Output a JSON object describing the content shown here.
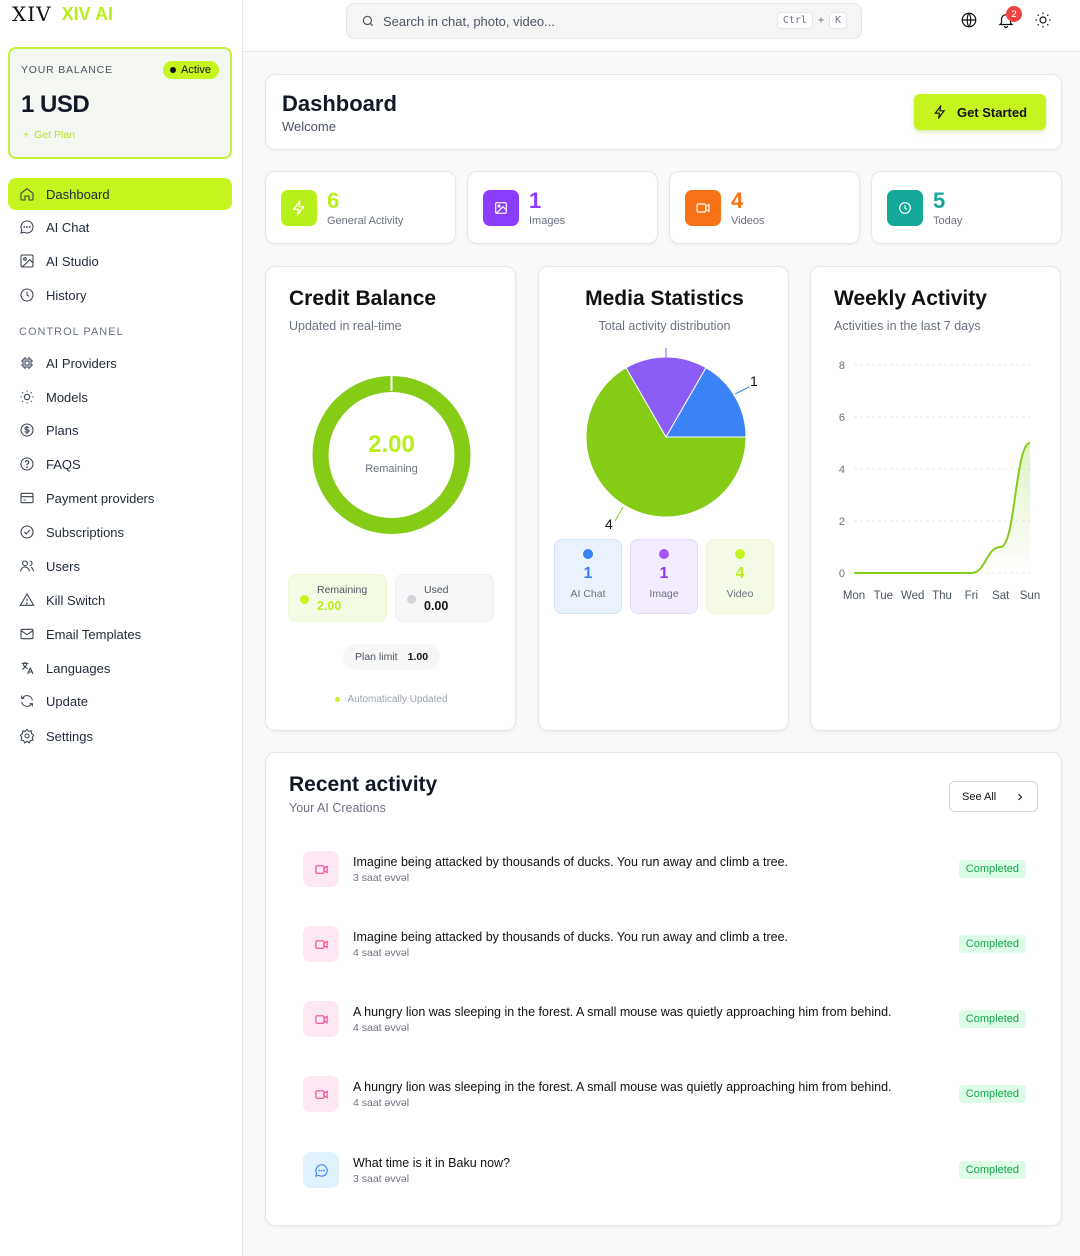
{
  "app": {
    "logo_mark": "XIV",
    "name": "XIV AI"
  },
  "balance": {
    "label": "YOUR BALANCE",
    "status": "Active",
    "amount": "1 USD",
    "get_plan": "Get Plan"
  },
  "sidebar": {
    "items": [
      {
        "label": "Dashboard",
        "icon": "home-icon"
      },
      {
        "label": "AI Chat",
        "icon": "chat-icon"
      },
      {
        "label": "AI Studio",
        "icon": "image-icon"
      },
      {
        "label": "History",
        "icon": "clock-icon"
      }
    ],
    "section_label": "CONTROL PANEL",
    "control_items": [
      {
        "label": "AI Providers",
        "icon": "chip-icon"
      },
      {
        "label": "Models",
        "icon": "bulb-icon"
      },
      {
        "label": "Plans",
        "icon": "dollar-icon"
      },
      {
        "label": "FAQS",
        "icon": "help-icon"
      },
      {
        "label": "Payment providers",
        "icon": "card-icon"
      },
      {
        "label": "Subscriptions",
        "icon": "check-circle-icon"
      },
      {
        "label": "Users",
        "icon": "users-icon"
      },
      {
        "label": "Kill Switch",
        "icon": "warning-icon"
      },
      {
        "label": "Email Templates",
        "icon": "mail-icon"
      },
      {
        "label": "Languages",
        "icon": "translate-icon"
      },
      {
        "label": "Update",
        "icon": "refresh-icon"
      },
      {
        "label": "Settings",
        "icon": "gear-icon"
      }
    ]
  },
  "search": {
    "placeholder": "Search in chat, photo, video...",
    "kbd_1": "Ctrl",
    "kbd_plus": "+",
    "kbd_2": "K"
  },
  "notifications": {
    "count": "2"
  },
  "header": {
    "title": "Dashboard",
    "subtitle": "Welcome",
    "cta": "Get Started"
  },
  "stats": [
    {
      "value": "6",
      "label": "General Activity",
      "color": "#b7ef1a",
      "icon": "bolt-icon"
    },
    {
      "value": "1",
      "label": "Images",
      "color": "#8b3dff",
      "icon": "image-icon"
    },
    {
      "value": "4",
      "label": "Videos",
      "color": "#f97316",
      "icon": "video-icon"
    },
    {
      "value": "5",
      "label": "Today",
      "color": "#14a89a",
      "icon": "clock-icon"
    }
  ],
  "credit": {
    "title": "Credit Balance",
    "subtitle": "Updated in real-time",
    "center_value": "2.00",
    "center_label": "Remaining",
    "remaining_fraction": 1.0,
    "remaining_label": "Remaining",
    "remaining_value": "2.00",
    "used_label": "Used",
    "used_value": "0.00",
    "plan_limit_label": "Plan limit",
    "plan_limit_value": "1.00",
    "auto_label": "Automatically Updated"
  },
  "media": {
    "title": "Media Statistics",
    "subtitle": "Total activity distribution",
    "callout_top": "1",
    "callout_bottom": "4",
    "legend": [
      {
        "value": "1",
        "label": "AI Chat",
        "color": "#3b82f6"
      },
      {
        "value": "1",
        "label": "Image",
        "color": "#8b5cf6"
      },
      {
        "value": "4",
        "label": "Video",
        "color": "#b7ef1a"
      }
    ]
  },
  "weekly": {
    "title": "Weekly Activity",
    "subtitle": "Activities in the last 7 days"
  },
  "chart_data": [
    {
      "type": "pie",
      "title": "Media Statistics",
      "categories": [
        "AI Chat",
        "Image",
        "Video"
      ],
      "values": [
        1,
        1,
        4
      ],
      "colors": [
        "#3b82f6",
        "#8b5cf6",
        "#84cc16"
      ]
    },
    {
      "type": "area",
      "title": "Weekly Activity",
      "categories": [
        "Mon",
        "Tue",
        "Wed",
        "Thu",
        "Fri",
        "Sat",
        "Sun"
      ],
      "values": [
        0,
        0,
        0,
        0,
        0,
        1,
        5
      ],
      "ylim": [
        0,
        8
      ],
      "yticks": [
        "0",
        "2",
        "4",
        "6",
        "8"
      ],
      "grid": true
    }
  ],
  "recent": {
    "title": "Recent activity",
    "subtitle": "Your AI Creations",
    "see_all": "See All",
    "items": [
      {
        "title": "Imagine being attacked by thousands of ducks. You run away and climb a tree.",
        "time": "3 saat əvvəl",
        "status": "Completed",
        "type": "video"
      },
      {
        "title": "Imagine being attacked by thousands of ducks. You run away and climb a tree.",
        "time": "4 saat əvvəl",
        "status": "Completed",
        "type": "video"
      },
      {
        "title": "A hungry lion was sleeping in the forest. A small mouse was quietly approaching him from behind.",
        "time": "4 saat əvvəl",
        "status": "Completed",
        "type": "video"
      },
      {
        "title": "A hungry lion was sleeping in the forest. A small mouse was quietly approaching him from behind.",
        "time": "4 saat əvvəl",
        "status": "Completed",
        "type": "video"
      },
      {
        "title": "What time is it in Baku now?",
        "time": "3 saat əvvəl",
        "status": "Completed",
        "type": "chat"
      }
    ]
  }
}
